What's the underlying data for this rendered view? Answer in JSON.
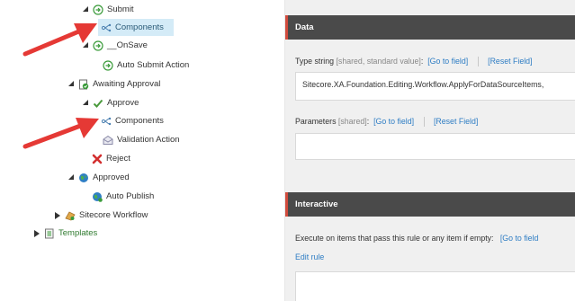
{
  "tree": {
    "items": [
      {
        "label": "Submit",
        "icon": "workflow-command-icon"
      },
      {
        "label": "Components",
        "icon": "components-icon"
      },
      {
        "label": "__OnSave",
        "icon": "workflow-command-icon"
      },
      {
        "label": "Auto Submit Action",
        "icon": "workflow-action-icon"
      },
      {
        "label": "Awaiting Approval",
        "icon": "workflow-state-icon"
      },
      {
        "label": "Approve",
        "icon": "checkmark-icon"
      },
      {
        "label": "Components",
        "icon": "components-icon"
      },
      {
        "label": "Validation Action",
        "icon": "validation-icon"
      },
      {
        "label": "Reject",
        "icon": "red-x-icon"
      },
      {
        "label": "Approved",
        "icon": "globe-icon"
      },
      {
        "label": "Auto Publish",
        "icon": "globe-publish-icon"
      },
      {
        "label": "Sitecore Workflow",
        "icon": "workflow-folder-icon"
      },
      {
        "label": "Templates",
        "icon": "templates-icon"
      }
    ]
  },
  "content": {
    "data_section": {
      "title": "Data",
      "type_string": {
        "label": "Type string",
        "meta": "[shared, standard value]",
        "goto": "[Go to field]",
        "reset": "[Reset Field]",
        "value": "Sitecore.XA.Foundation.Editing.Workflow.ApplyForDataSourceItems,"
      },
      "parameters": {
        "label": "Parameters",
        "meta": "[shared]",
        "goto": "[Go to field]",
        "reset": "[Reset Field]",
        "value": ""
      }
    },
    "interactive_section": {
      "title": "Interactive",
      "execute": {
        "label": "Execute on items that pass this rule or any item if empty:",
        "goto": "[Go to field"
      },
      "edit_rule": "Edit rule"
    }
  },
  "colors": {
    "section_header": "#4a4a4a",
    "section_accent": "#d14b3d",
    "link": "#2e7dc4",
    "selected_row": "#d4ebf7",
    "arrow": "#e53935"
  }
}
